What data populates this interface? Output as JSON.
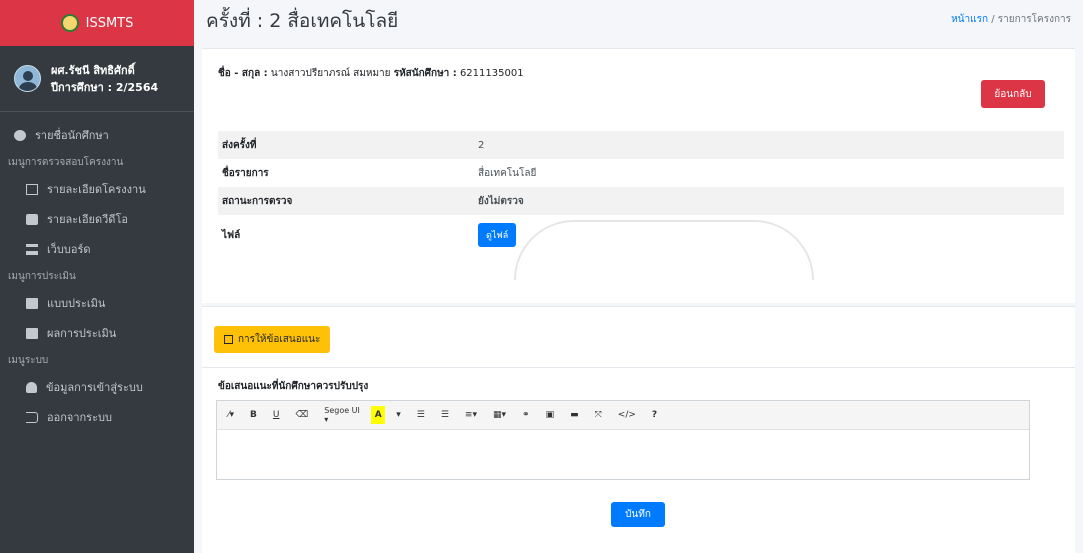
{
  "brand": {
    "name": "ISSMTS"
  },
  "user": {
    "name": "ผศ.รัชนี สิทธิศักดิ์",
    "year": "ปีการศึกษา : 2/2564"
  },
  "sidebar": {
    "top_item": "รายชื่อนักศึกษา",
    "section1": "เมนูการตรวจสอบโครงงาน",
    "project_detail": "รายละเอียดโครงงาน",
    "video_detail": "รายละเอียดวีดีโอ",
    "webboard": "เว็บบอร์ด",
    "section2": "เมนูการประเมิน",
    "eval_form": "แบบประเมิน",
    "eval_result": "ผลการประเมิน",
    "section3": "เมนูระบบ",
    "login_info": "ข้อมูลการเข้าสู่ระบบ",
    "logout": "ออกจากระบบ"
  },
  "header": {
    "title": "ครั้งที่ : 2 สื่อเทคโนโลยี",
    "breadcrumb_home": "หน้าแรก",
    "breadcrumb_sep": " / ",
    "breadcrumb_current": "รายการโครงการ"
  },
  "student": {
    "name_label": "ชื่อ - สกุล :",
    "name": "นางสาวปรียาภรณ์ สมหมาย",
    "id_label": "รหัสนักศึกษา :",
    "id": "6211135001"
  },
  "back_button": "ย้อนกลับ",
  "info": {
    "round_label": "ส่งครั้งที่",
    "round_value": "2",
    "title_label": "ชื่อรายการ",
    "title_value": "สื่อเทคโนโลยี",
    "status_label": "สถานะการตรวจ",
    "status_value": "ยังไม่ตรวจ",
    "file_label": "ไฟล์",
    "file_button": "ดูไฟล์"
  },
  "suggest_button": "การให้ข้อเสนอแนะ",
  "suggest_label": "ข้อเสนอแนะที่นักศึกษาควรปรับปรุง",
  "toolbar": {
    "magic": "⁄▾",
    "bold": "B",
    "underline": "U",
    "eraser": "⌫",
    "font": "Segoe UI ▾",
    "color": "A",
    "color_dd": "▾",
    "ul": "☰",
    "ol": "☰",
    "align": "≡▾",
    "table": "▦▾",
    "link": "⚭",
    "image": "▣",
    "video": "▬",
    "fullscreen": "⤧",
    "code": "</>",
    "help": "?"
  },
  "save_button": "บันทึก",
  "colors": {
    "brand": "#dc3545",
    "sidebar": "#343a40",
    "primary": "#007bff",
    "warning": "#ffc107"
  }
}
